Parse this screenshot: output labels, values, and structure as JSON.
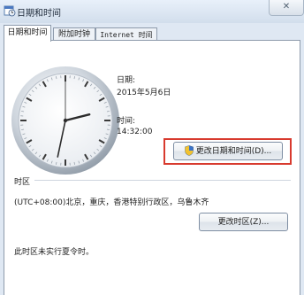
{
  "window": {
    "title": "日期和时间",
    "close_glyph": "✕"
  },
  "tabs": [
    {
      "label": "日期和时间"
    },
    {
      "label": "附加时钟"
    },
    {
      "label": "Internet 时间"
    }
  ],
  "date_section": {
    "date_label": "日期:",
    "date_value": "2015年5月6日",
    "time_label": "时间:",
    "time_value": "14:32:00",
    "change_button": "更改日期和时间(D)..."
  },
  "timezone_section": {
    "heading": "时区",
    "value": "(UTC+08:00)北京，重庆，香港特别行政区，乌鲁木齐",
    "change_button": "更改时区(Z)...",
    "dst_note": "此时区未实行夏令时。"
  },
  "clock": {
    "hours": 14,
    "minutes": 32,
    "seconds": 0
  },
  "icons": [
    "calendar-clock-icon",
    "close-icon",
    "uac-shield-icon"
  ],
  "colors": {
    "highlight": "#d83a2e",
    "titlebar": "#d2deec",
    "panel": "#ffffff"
  }
}
